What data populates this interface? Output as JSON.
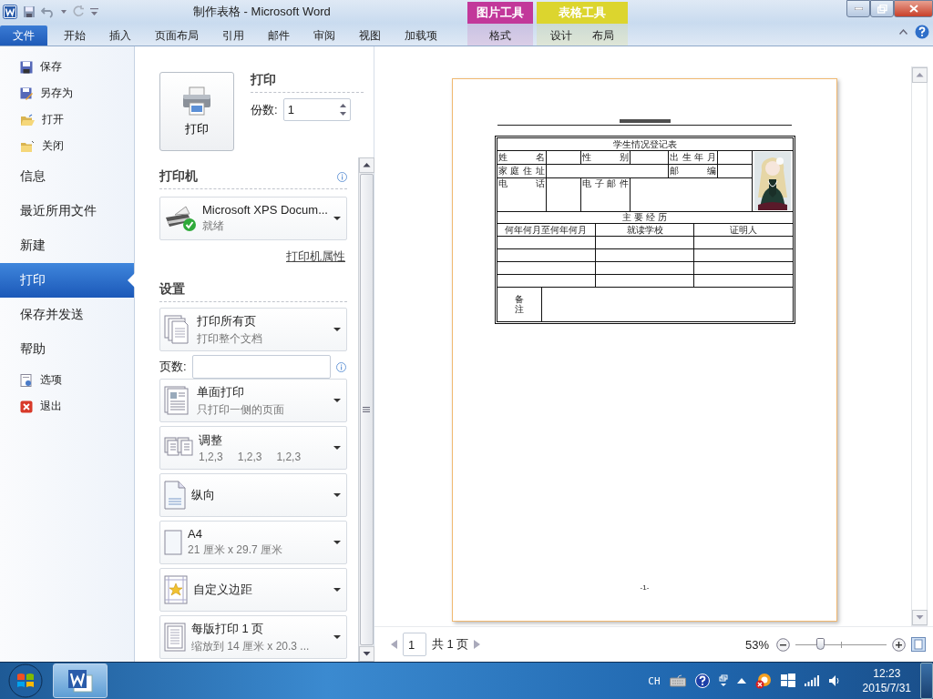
{
  "window": {
    "title": "制作表格 - Microsoft Word"
  },
  "contextual_groups": [
    {
      "label": "图片工具",
      "color": "#c2389a",
      "tabs": [
        {
          "label": "格式",
          "selected": false
        }
      ]
    },
    {
      "label": "表格工具",
      "color": "#dcd52e",
      "tabs": [
        {
          "label": "设计",
          "selected": false
        },
        {
          "label": "布局",
          "selected": false
        }
      ]
    }
  ],
  "ribbon_tabs": [
    {
      "label": "文件",
      "selected": true
    },
    {
      "label": "开始",
      "selected": false
    },
    {
      "label": "插入",
      "selected": false
    },
    {
      "label": "页面布局",
      "selected": false
    },
    {
      "label": "引用",
      "selected": false
    },
    {
      "label": "邮件",
      "selected": false
    },
    {
      "label": "审阅",
      "selected": false
    },
    {
      "label": "视图",
      "selected": false
    },
    {
      "label": "加载项",
      "selected": false
    }
  ],
  "nav": {
    "items": [
      {
        "kind": "command",
        "label": "保存",
        "selected": false
      },
      {
        "kind": "command",
        "label": "另存为",
        "selected": false
      },
      {
        "kind": "command",
        "label": "打开",
        "selected": false
      },
      {
        "kind": "command",
        "label": "关闭",
        "selected": false
      },
      {
        "kind": "section",
        "label": "信息",
        "selected": false
      },
      {
        "kind": "section",
        "label": "最近所用文件",
        "selected": false
      },
      {
        "kind": "section",
        "label": "新建",
        "selected": false
      },
      {
        "kind": "section",
        "label": "打印",
        "selected": true
      },
      {
        "kind": "section",
        "label": "保存并发送",
        "selected": false
      },
      {
        "kind": "section",
        "label": "帮助",
        "selected": false
      },
      {
        "kind": "command",
        "label": "选项",
        "selected": false
      },
      {
        "kind": "command",
        "label": "退出",
        "selected": false
      }
    ]
  },
  "print": {
    "button": "打印",
    "heading": "打印",
    "copies_label": "份数:",
    "copies": "1"
  },
  "printer": {
    "heading": "打印机",
    "name": "Microsoft XPS Docum...",
    "status": "就绪",
    "properties_link": "打印机属性"
  },
  "settings": {
    "heading": "设置",
    "pages_label": "页数:",
    "options": [
      {
        "kind": "dropdown",
        "title": "打印所有页",
        "subtitles": [
          "打印整个文档"
        ]
      },
      {
        "kind": "field"
      },
      {
        "kind": "dropdown",
        "title": "单面打印",
        "subtitles": [
          "只打印一侧的页面"
        ]
      },
      {
        "kind": "dropdown",
        "title": "调整",
        "subtitles": [
          "1,2,3",
          "1,2,3",
          "1,2,3"
        ]
      },
      {
        "kind": "dropdown",
        "title": "纵向"
      },
      {
        "kind": "dropdown",
        "title": "A4",
        "subtitles": [
          "21 厘米 x 29.7 厘米"
        ]
      },
      {
        "kind": "dropdown",
        "title": "自定义边距"
      },
      {
        "kind": "dropdown",
        "title": "每版打印 1 页",
        "subtitles": [
          "缩放到 14 厘米 x 20.3 ..."
        ]
      }
    ]
  },
  "document": {
    "table_title": "学生情况登记表",
    "row_1": [
      "姓 名",
      "性 别",
      "出 生 年 月"
    ],
    "row_2": [
      "家 庭 住 址",
      "邮 编"
    ],
    "row_3": [
      "电 话",
      "电 子 邮 件"
    ],
    "section": "主 要 经 历",
    "columns": [
      "何年何月至何年何月",
      "就读学校",
      "证明人"
    ],
    "remark": "备注",
    "footer": "-1-"
  },
  "pager": {
    "page": "1",
    "total": "共 1 页"
  },
  "zoom": {
    "reading": "53%",
    "level": 0.27
  },
  "taskbar": {
    "language": "CH",
    "time": "12:23",
    "date": "2015/7/31"
  }
}
